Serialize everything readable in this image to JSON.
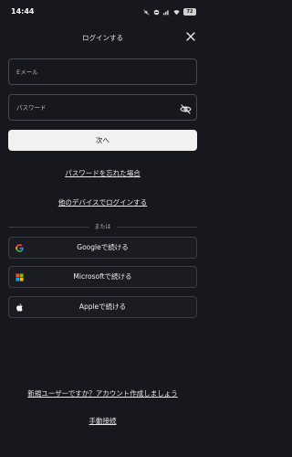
{
  "status": {
    "time": "14:44",
    "battery": "72"
  },
  "header": {
    "title": "ログインする"
  },
  "form": {
    "email_placeholder": "Eメール",
    "password_placeholder": "パスワード",
    "next_label": "次へ"
  },
  "links": {
    "forgot_password": "パスワードを忘れた場合",
    "other_device": "他のデバイスでログインする",
    "signup": "新規ユーザーですか？アカウント作成しましょう",
    "manual_connect": "手動接続"
  },
  "divider": {
    "label": "または"
  },
  "sso": {
    "google": "Googleで続ける",
    "microsoft": "Microsoftで続ける",
    "apple": "Appleで続ける"
  },
  "icons": {
    "close": "close-icon",
    "eye": "eye-slash-icon",
    "google": "google-icon",
    "microsoft": "microsoft-icon",
    "apple": "apple-icon"
  },
  "colors": {
    "background": "#16181d",
    "primary_button": "#f1f1f1",
    "border": "#444850"
  }
}
